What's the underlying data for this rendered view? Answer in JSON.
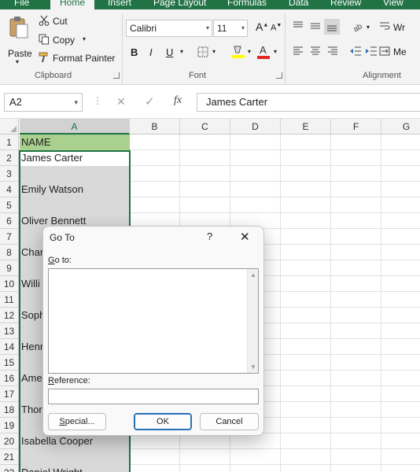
{
  "tabs": [
    "File",
    "Home",
    "Insert",
    "Page Layout",
    "Formulas",
    "Data",
    "Review",
    "View"
  ],
  "clipboard": {
    "paste": "Paste",
    "cut": "Cut",
    "copy": "Copy",
    "format_painter": "Format Painter",
    "group_label": "Clipboard"
  },
  "font": {
    "name": "Calibri",
    "size": "11",
    "bold": "B",
    "italic": "I",
    "underline": "U",
    "group_label": "Font",
    "font_color": "#e32626",
    "fill_color": "#ffff00"
  },
  "alignment": {
    "wrap": "Wr",
    "merge": "Me",
    "group_label": "Alignment"
  },
  "formula_bar": {
    "name_box": "A2",
    "cancel": "✕",
    "enter": "✓",
    "fx": "fx",
    "value": "James Carter"
  },
  "grid": {
    "columns": [
      "A",
      "B",
      "C",
      "D",
      "E",
      "F",
      "G"
    ],
    "rows": [
      "1",
      "2",
      "3",
      "4",
      "5",
      "6",
      "7",
      "8",
      "9",
      "10",
      "11",
      "12",
      "13",
      "14",
      "15",
      "16",
      "17",
      "18",
      "19",
      "20",
      "21",
      "22"
    ],
    "column_a": [
      "NAME",
      "James Carter",
      "",
      "Emily Watson",
      "",
      "Oliver Bennett",
      "",
      "Char",
      "",
      "Willi",
      "",
      "Soph",
      "",
      "Henr",
      "",
      "Ame",
      "",
      "Thor",
      "",
      "Isabella Cooper",
      "",
      "Daniel Wright"
    ]
  },
  "dialog": {
    "title": "Go To",
    "help": "?",
    "close": "✕",
    "goto_label": "Go to:",
    "reference_label": "Reference:",
    "special": "Special...",
    "ok": "OK",
    "cancel": "Cancel"
  },
  "colors": {
    "accent": "#217346",
    "header_fill": "#a9d08e",
    "selection_fill": "#d9d9d9"
  }
}
